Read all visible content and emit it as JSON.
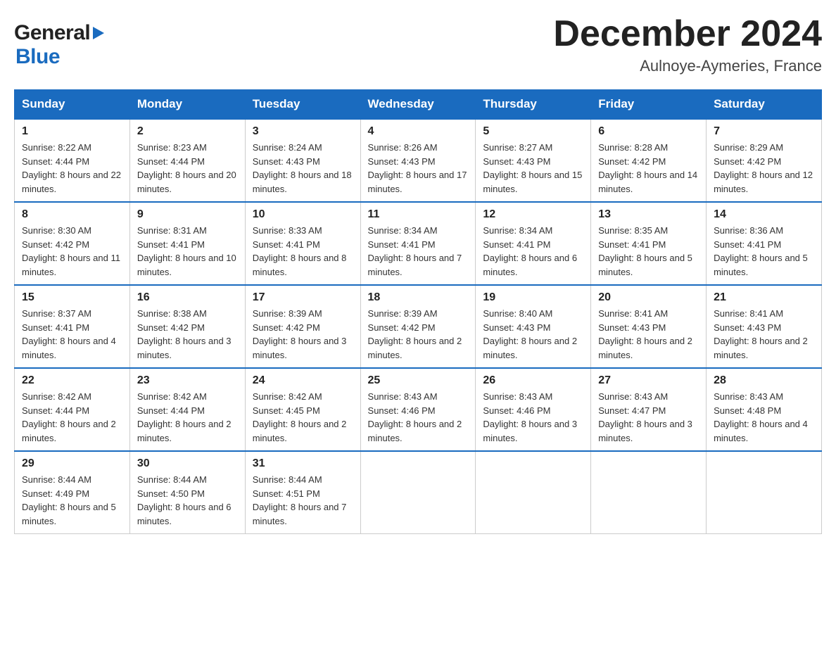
{
  "header": {
    "logo_general": "General",
    "logo_blue": "Blue",
    "month_title": "December 2024",
    "location": "Aulnoye-Aymeries, France"
  },
  "days_of_week": [
    "Sunday",
    "Monday",
    "Tuesday",
    "Wednesday",
    "Thursday",
    "Friday",
    "Saturday"
  ],
  "weeks": [
    [
      {
        "day": "1",
        "sunrise": "8:22 AM",
        "sunset": "4:44 PM",
        "daylight": "8 hours and 22 minutes."
      },
      {
        "day": "2",
        "sunrise": "8:23 AM",
        "sunset": "4:44 PM",
        "daylight": "8 hours and 20 minutes."
      },
      {
        "day": "3",
        "sunrise": "8:24 AM",
        "sunset": "4:43 PM",
        "daylight": "8 hours and 18 minutes."
      },
      {
        "day": "4",
        "sunrise": "8:26 AM",
        "sunset": "4:43 PM",
        "daylight": "8 hours and 17 minutes."
      },
      {
        "day": "5",
        "sunrise": "8:27 AM",
        "sunset": "4:43 PM",
        "daylight": "8 hours and 15 minutes."
      },
      {
        "day": "6",
        "sunrise": "8:28 AM",
        "sunset": "4:42 PM",
        "daylight": "8 hours and 14 minutes."
      },
      {
        "day": "7",
        "sunrise": "8:29 AM",
        "sunset": "4:42 PM",
        "daylight": "8 hours and 12 minutes."
      }
    ],
    [
      {
        "day": "8",
        "sunrise": "8:30 AM",
        "sunset": "4:42 PM",
        "daylight": "8 hours and 11 minutes."
      },
      {
        "day": "9",
        "sunrise": "8:31 AM",
        "sunset": "4:41 PM",
        "daylight": "8 hours and 10 minutes."
      },
      {
        "day": "10",
        "sunrise": "8:33 AM",
        "sunset": "4:41 PM",
        "daylight": "8 hours and 8 minutes."
      },
      {
        "day": "11",
        "sunrise": "8:34 AM",
        "sunset": "4:41 PM",
        "daylight": "8 hours and 7 minutes."
      },
      {
        "day": "12",
        "sunrise": "8:34 AM",
        "sunset": "4:41 PM",
        "daylight": "8 hours and 6 minutes."
      },
      {
        "day": "13",
        "sunrise": "8:35 AM",
        "sunset": "4:41 PM",
        "daylight": "8 hours and 5 minutes."
      },
      {
        "day": "14",
        "sunrise": "8:36 AM",
        "sunset": "4:41 PM",
        "daylight": "8 hours and 5 minutes."
      }
    ],
    [
      {
        "day": "15",
        "sunrise": "8:37 AM",
        "sunset": "4:41 PM",
        "daylight": "8 hours and 4 minutes."
      },
      {
        "day": "16",
        "sunrise": "8:38 AM",
        "sunset": "4:42 PM",
        "daylight": "8 hours and 3 minutes."
      },
      {
        "day": "17",
        "sunrise": "8:39 AM",
        "sunset": "4:42 PM",
        "daylight": "8 hours and 3 minutes."
      },
      {
        "day": "18",
        "sunrise": "8:39 AM",
        "sunset": "4:42 PM",
        "daylight": "8 hours and 2 minutes."
      },
      {
        "day": "19",
        "sunrise": "8:40 AM",
        "sunset": "4:43 PM",
        "daylight": "8 hours and 2 minutes."
      },
      {
        "day": "20",
        "sunrise": "8:41 AM",
        "sunset": "4:43 PM",
        "daylight": "8 hours and 2 minutes."
      },
      {
        "day": "21",
        "sunrise": "8:41 AM",
        "sunset": "4:43 PM",
        "daylight": "8 hours and 2 minutes."
      }
    ],
    [
      {
        "day": "22",
        "sunrise": "8:42 AM",
        "sunset": "4:44 PM",
        "daylight": "8 hours and 2 minutes."
      },
      {
        "day": "23",
        "sunrise": "8:42 AM",
        "sunset": "4:44 PM",
        "daylight": "8 hours and 2 minutes."
      },
      {
        "day": "24",
        "sunrise": "8:42 AM",
        "sunset": "4:45 PM",
        "daylight": "8 hours and 2 minutes."
      },
      {
        "day": "25",
        "sunrise": "8:43 AM",
        "sunset": "4:46 PM",
        "daylight": "8 hours and 2 minutes."
      },
      {
        "day": "26",
        "sunrise": "8:43 AM",
        "sunset": "4:46 PM",
        "daylight": "8 hours and 3 minutes."
      },
      {
        "day": "27",
        "sunrise": "8:43 AM",
        "sunset": "4:47 PM",
        "daylight": "8 hours and 3 minutes."
      },
      {
        "day": "28",
        "sunrise": "8:43 AM",
        "sunset": "4:48 PM",
        "daylight": "8 hours and 4 minutes."
      }
    ],
    [
      {
        "day": "29",
        "sunrise": "8:44 AM",
        "sunset": "4:49 PM",
        "daylight": "8 hours and 5 minutes."
      },
      {
        "day": "30",
        "sunrise": "8:44 AM",
        "sunset": "4:50 PM",
        "daylight": "8 hours and 6 minutes."
      },
      {
        "day": "31",
        "sunrise": "8:44 AM",
        "sunset": "4:51 PM",
        "daylight": "8 hours and 7 minutes."
      },
      null,
      null,
      null,
      null
    ]
  ],
  "labels": {
    "sunrise": "Sunrise:",
    "sunset": "Sunset:",
    "daylight": "Daylight:"
  }
}
